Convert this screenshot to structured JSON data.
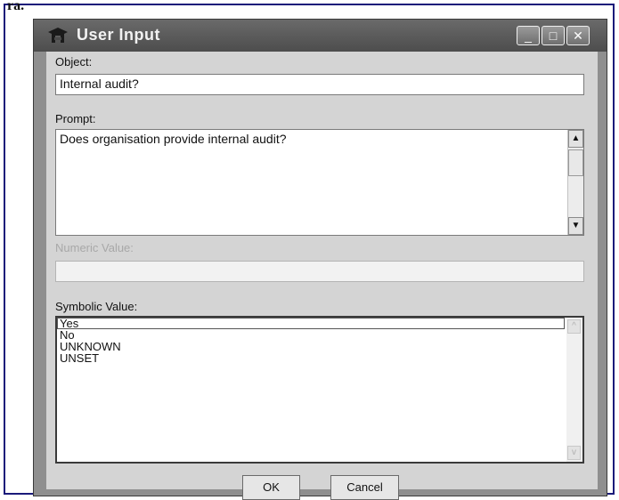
{
  "corner_text": "ra.",
  "window": {
    "title": "User Input",
    "app_icon": "app-icon",
    "controls": {
      "minimize": "_",
      "maximize": "□",
      "close": "✕"
    }
  },
  "object": {
    "label": "Object:",
    "value": "Internal audit?"
  },
  "prompt": {
    "label": "Prompt:",
    "value": "Does organisation provide internal audit?"
  },
  "numeric": {
    "label": "Numeric Value:",
    "value": ""
  },
  "symbolic": {
    "label": "Symbolic Value:",
    "options": [
      "Yes",
      "No",
      "UNKNOWN",
      "UNSET"
    ]
  },
  "buttons": {
    "ok": "OK",
    "cancel": "Cancel"
  },
  "colors": {
    "titlebar": "#5a5a5a",
    "client": "#d4d4d4"
  }
}
